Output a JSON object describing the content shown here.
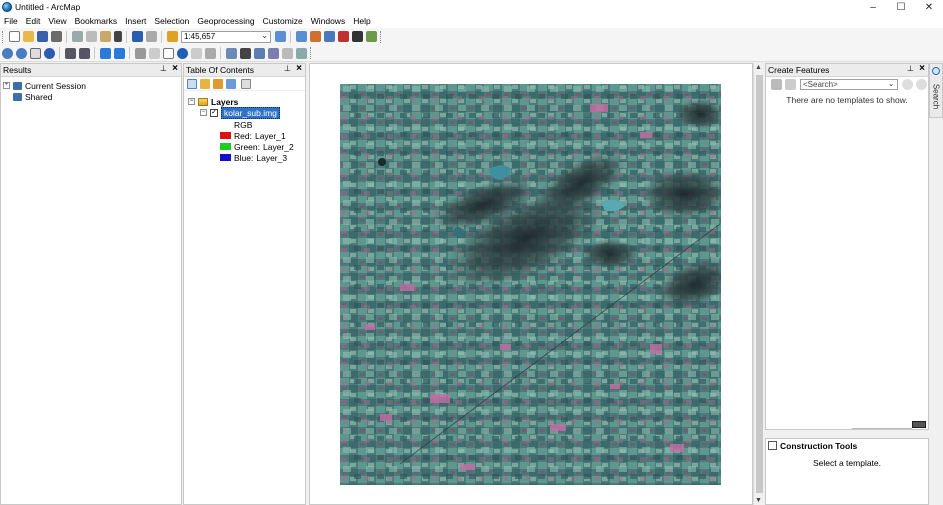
{
  "window": {
    "title": "Untitled - ArcMap",
    "minimize": "–",
    "maximize": "☐",
    "close": "✕"
  },
  "menu": [
    "File",
    "Edit",
    "View",
    "Bookmarks",
    "Insert",
    "Selection",
    "Geoprocessing",
    "Customize",
    "Windows",
    "Help"
  ],
  "toolbar": {
    "scale": "1:45,657"
  },
  "results": {
    "title": "Results",
    "items": [
      "Current Session",
      "Shared"
    ]
  },
  "toc": {
    "title": "Table Of Contents",
    "layers_label": "Layers",
    "layer_name": "kolar_sub.img",
    "rgb_label": "RGB",
    "bands": [
      {
        "channel": "Red:",
        "layer": "Layer_1",
        "color": "#e01010"
      },
      {
        "channel": "Green:",
        "layer": "Layer_2",
        "color": "#22cc22"
      },
      {
        "channel": "Blue:",
        "layer": "Layer_3",
        "color": "#1010c8"
      }
    ]
  },
  "create_features": {
    "title": "Create Features",
    "search_placeholder": "<Search>",
    "empty_message": "There are no templates to show."
  },
  "construction_tools": {
    "title": "Construction Tools",
    "message": "Select a template."
  },
  "side_tab": {
    "label": "Search"
  },
  "colors": {
    "selection": "#3072c8",
    "panel_bg": "#ffffff",
    "chrome_bg": "#f0f0f0"
  }
}
